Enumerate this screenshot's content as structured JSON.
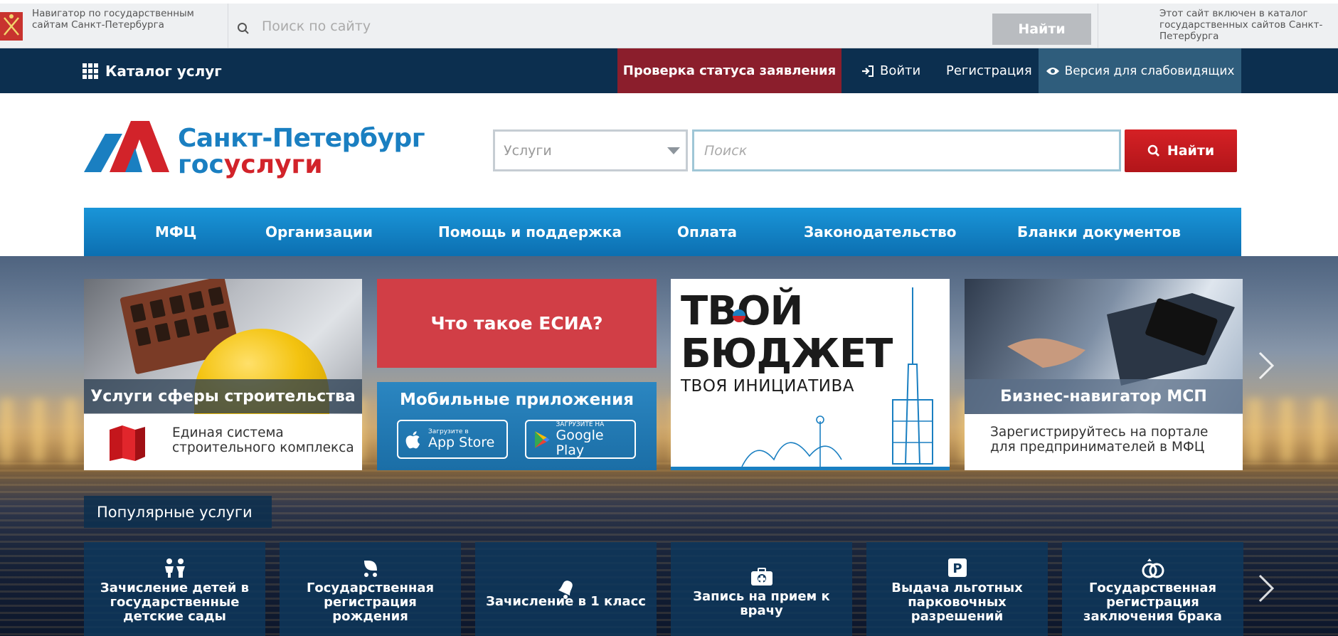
{
  "gov_strip": {
    "navigator_text": "Навигатор по государственным сайтам Санкт-Петербурга",
    "search_placeholder": "Поиск по сайту",
    "find_label": "Найти",
    "catalog_text": "Этот сайт включен в каталог государственных сайтов Санкт-Петербурга"
  },
  "dark_bar": {
    "catalog_label": "Каталог услуг",
    "status_label": "Проверка статуса заявления",
    "login_label": "Войти",
    "register_label": "Регистрация",
    "vision_label": "Версия для слабовидящих"
  },
  "logo": {
    "title": "Санкт-Петербург",
    "sub_blue": "гос",
    "sub_red": "услуги"
  },
  "search": {
    "select_value": "Услуги",
    "placeholder": "Поиск",
    "find_label": "Найти"
  },
  "menu": {
    "items": [
      "МФЦ",
      "Организации",
      "Помощь и поддержка",
      "Оплата",
      "Законодательство",
      "Бланки документов"
    ]
  },
  "cards": {
    "construction": {
      "band": "Услуги сферы строительства",
      "text_line1": "Единая система",
      "text_line2": "строительного комплекса"
    },
    "esia": "Что такое ЕСИА?",
    "mobile": {
      "title": "Мобильные приложения",
      "appstore_small": "Загрузите в",
      "appstore_big": "App Store",
      "googleplay_small": "ЗАГРУЗИТЕ НА",
      "googleplay_big": "Google Play"
    },
    "budget": {
      "line1": "ТВОЙ",
      "line2": "БЮДЖЕТ",
      "line3": "ТВОЯ ИНИЦИАТИВА"
    },
    "business": {
      "band": "Бизнес-навигатор МСП",
      "text_line1": "Зарегистрируйтесь на портале",
      "text_line2": "для предпринимателей в МФЦ"
    }
  },
  "popular": {
    "label": "Популярные услуги",
    "tiles": [
      {
        "label": "Зачисление детей в государственные детские сады",
        "icon": "children-icon"
      },
      {
        "label": "Государственная регистрация рождения",
        "icon": "stroller-icon"
      },
      {
        "label": "Зачисление в 1 класс",
        "icon": "bell-icon"
      },
      {
        "label": "Запись на прием к врачу",
        "icon": "medkit-icon"
      },
      {
        "label": "Выдача льготных парковочных разрешений",
        "icon": "parking-icon"
      },
      {
        "label": "Государственная регистрация заключения брака",
        "icon": "rings-icon"
      }
    ]
  },
  "colors": {
    "dark_bar": "#0c2f4f",
    "status_red": "#8b1e2c",
    "brand_blue": "#1a7fc1",
    "brand_red": "#d2232a",
    "menu_blue": "#1a95d8",
    "find_red": "#d52125"
  }
}
